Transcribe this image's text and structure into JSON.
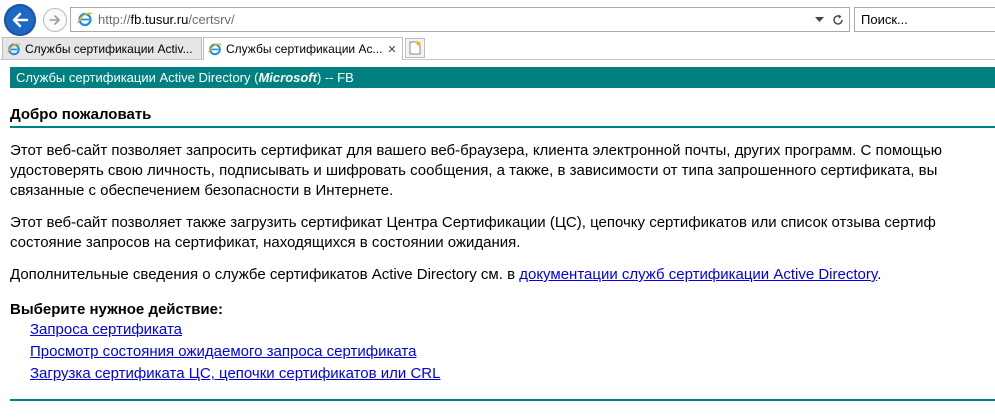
{
  "browser": {
    "url_prefix": "http://",
    "url_host": "fb.tusur.ru",
    "url_path": "/certsrv/",
    "search_placeholder": "Поиск...",
    "new_tab_label": "",
    "tabs": [
      {
        "label": "Службы сертификации Activ...",
        "active": false
      },
      {
        "label": "Службы сертификации Ac...",
        "active": true
      }
    ]
  },
  "page": {
    "header": {
      "prefix": "Службы сертификации Active Directory (",
      "vendor": "Microsoft",
      "suffix": ")  --  FB"
    },
    "welcome_title": "Добро пожаловать",
    "paragraph1_lines": [
      "Этот веб-сайт позволяет запросить сертификат для вашего веб-браузера, клиента электронной почты, других программ. С помощью",
      "удостоверять свою личность, подписывать и шифровать сообщения, а также, в зависимости от типа запрошенного сертификата, вы",
      "связанные с обеспечением безопасности в Интернете."
    ],
    "paragraph2_lines": [
      "Этот веб-сайт позволяет также загрузить сертификат Центра Сертификации (ЦС), цепочку сертификатов или список отзыва сертиф",
      "состояние запросов на сертификат, находящихся в состоянии ожидания."
    ],
    "paragraph3": {
      "text_before": "Дополнительные сведения о службе сертификатов Active Directory см. в ",
      "link_text": "документации служб сертификации Active Directory",
      "text_after": "."
    },
    "choose_title": "Выберите нужное действие:",
    "actions": [
      "Запроса сертификата",
      "Просмотр состояния ожидаемого запроса сертификата",
      "Загрузка сертификата ЦС, цепочки сертификатов или CRL"
    ]
  },
  "colors": {
    "header_bg": "#008080",
    "link": "#0000ee",
    "back_button": "#1e68c4"
  },
  "icons": [
    "back-arrow-icon",
    "forward-arrow-icon",
    "ie-logo-icon",
    "dropdown-arrow-icon",
    "refresh-icon",
    "new-tab-icon",
    "close-tab-icon"
  ]
}
